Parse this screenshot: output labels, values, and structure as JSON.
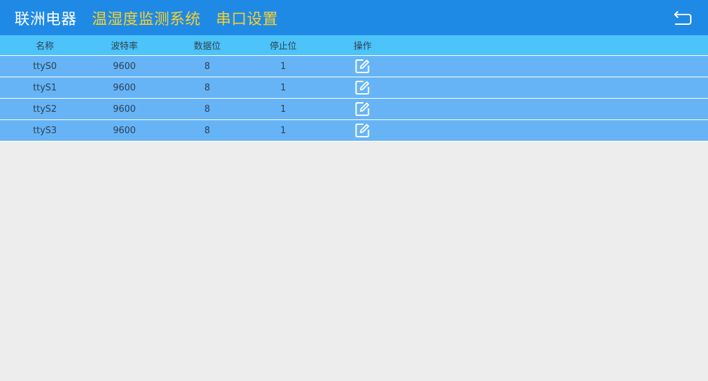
{
  "header": {
    "brand": "联洲电器",
    "title": "温湿度监测系统",
    "subtitle": "串口设置",
    "back_icon": "back-arrow-icon"
  },
  "table": {
    "columns": [
      "名称",
      "波特率",
      "数据位",
      "停止位",
      "操作"
    ],
    "rows": [
      {
        "name": "ttyS0",
        "baud": "9600",
        "data_bits": "8",
        "stop_bits": "1",
        "action_icon": "edit-icon"
      },
      {
        "name": "ttyS1",
        "baud": "9600",
        "data_bits": "8",
        "stop_bits": "1",
        "action_icon": "edit-icon"
      },
      {
        "name": "ttyS2",
        "baud": "9600",
        "data_bits": "8",
        "stop_bits": "1",
        "action_icon": "edit-icon"
      },
      {
        "name": "ttyS3",
        "baud": "9600",
        "data_bits": "8",
        "stop_bits": "1",
        "action_icon": "edit-icon"
      }
    ]
  },
  "colors": {
    "header_bg": "#1f8ae6",
    "title_accent": "#f8d02c",
    "table_head_bg": "#4cc3f9",
    "table_row_bg": "#66b4f6",
    "page_bg": "#ededed"
  }
}
